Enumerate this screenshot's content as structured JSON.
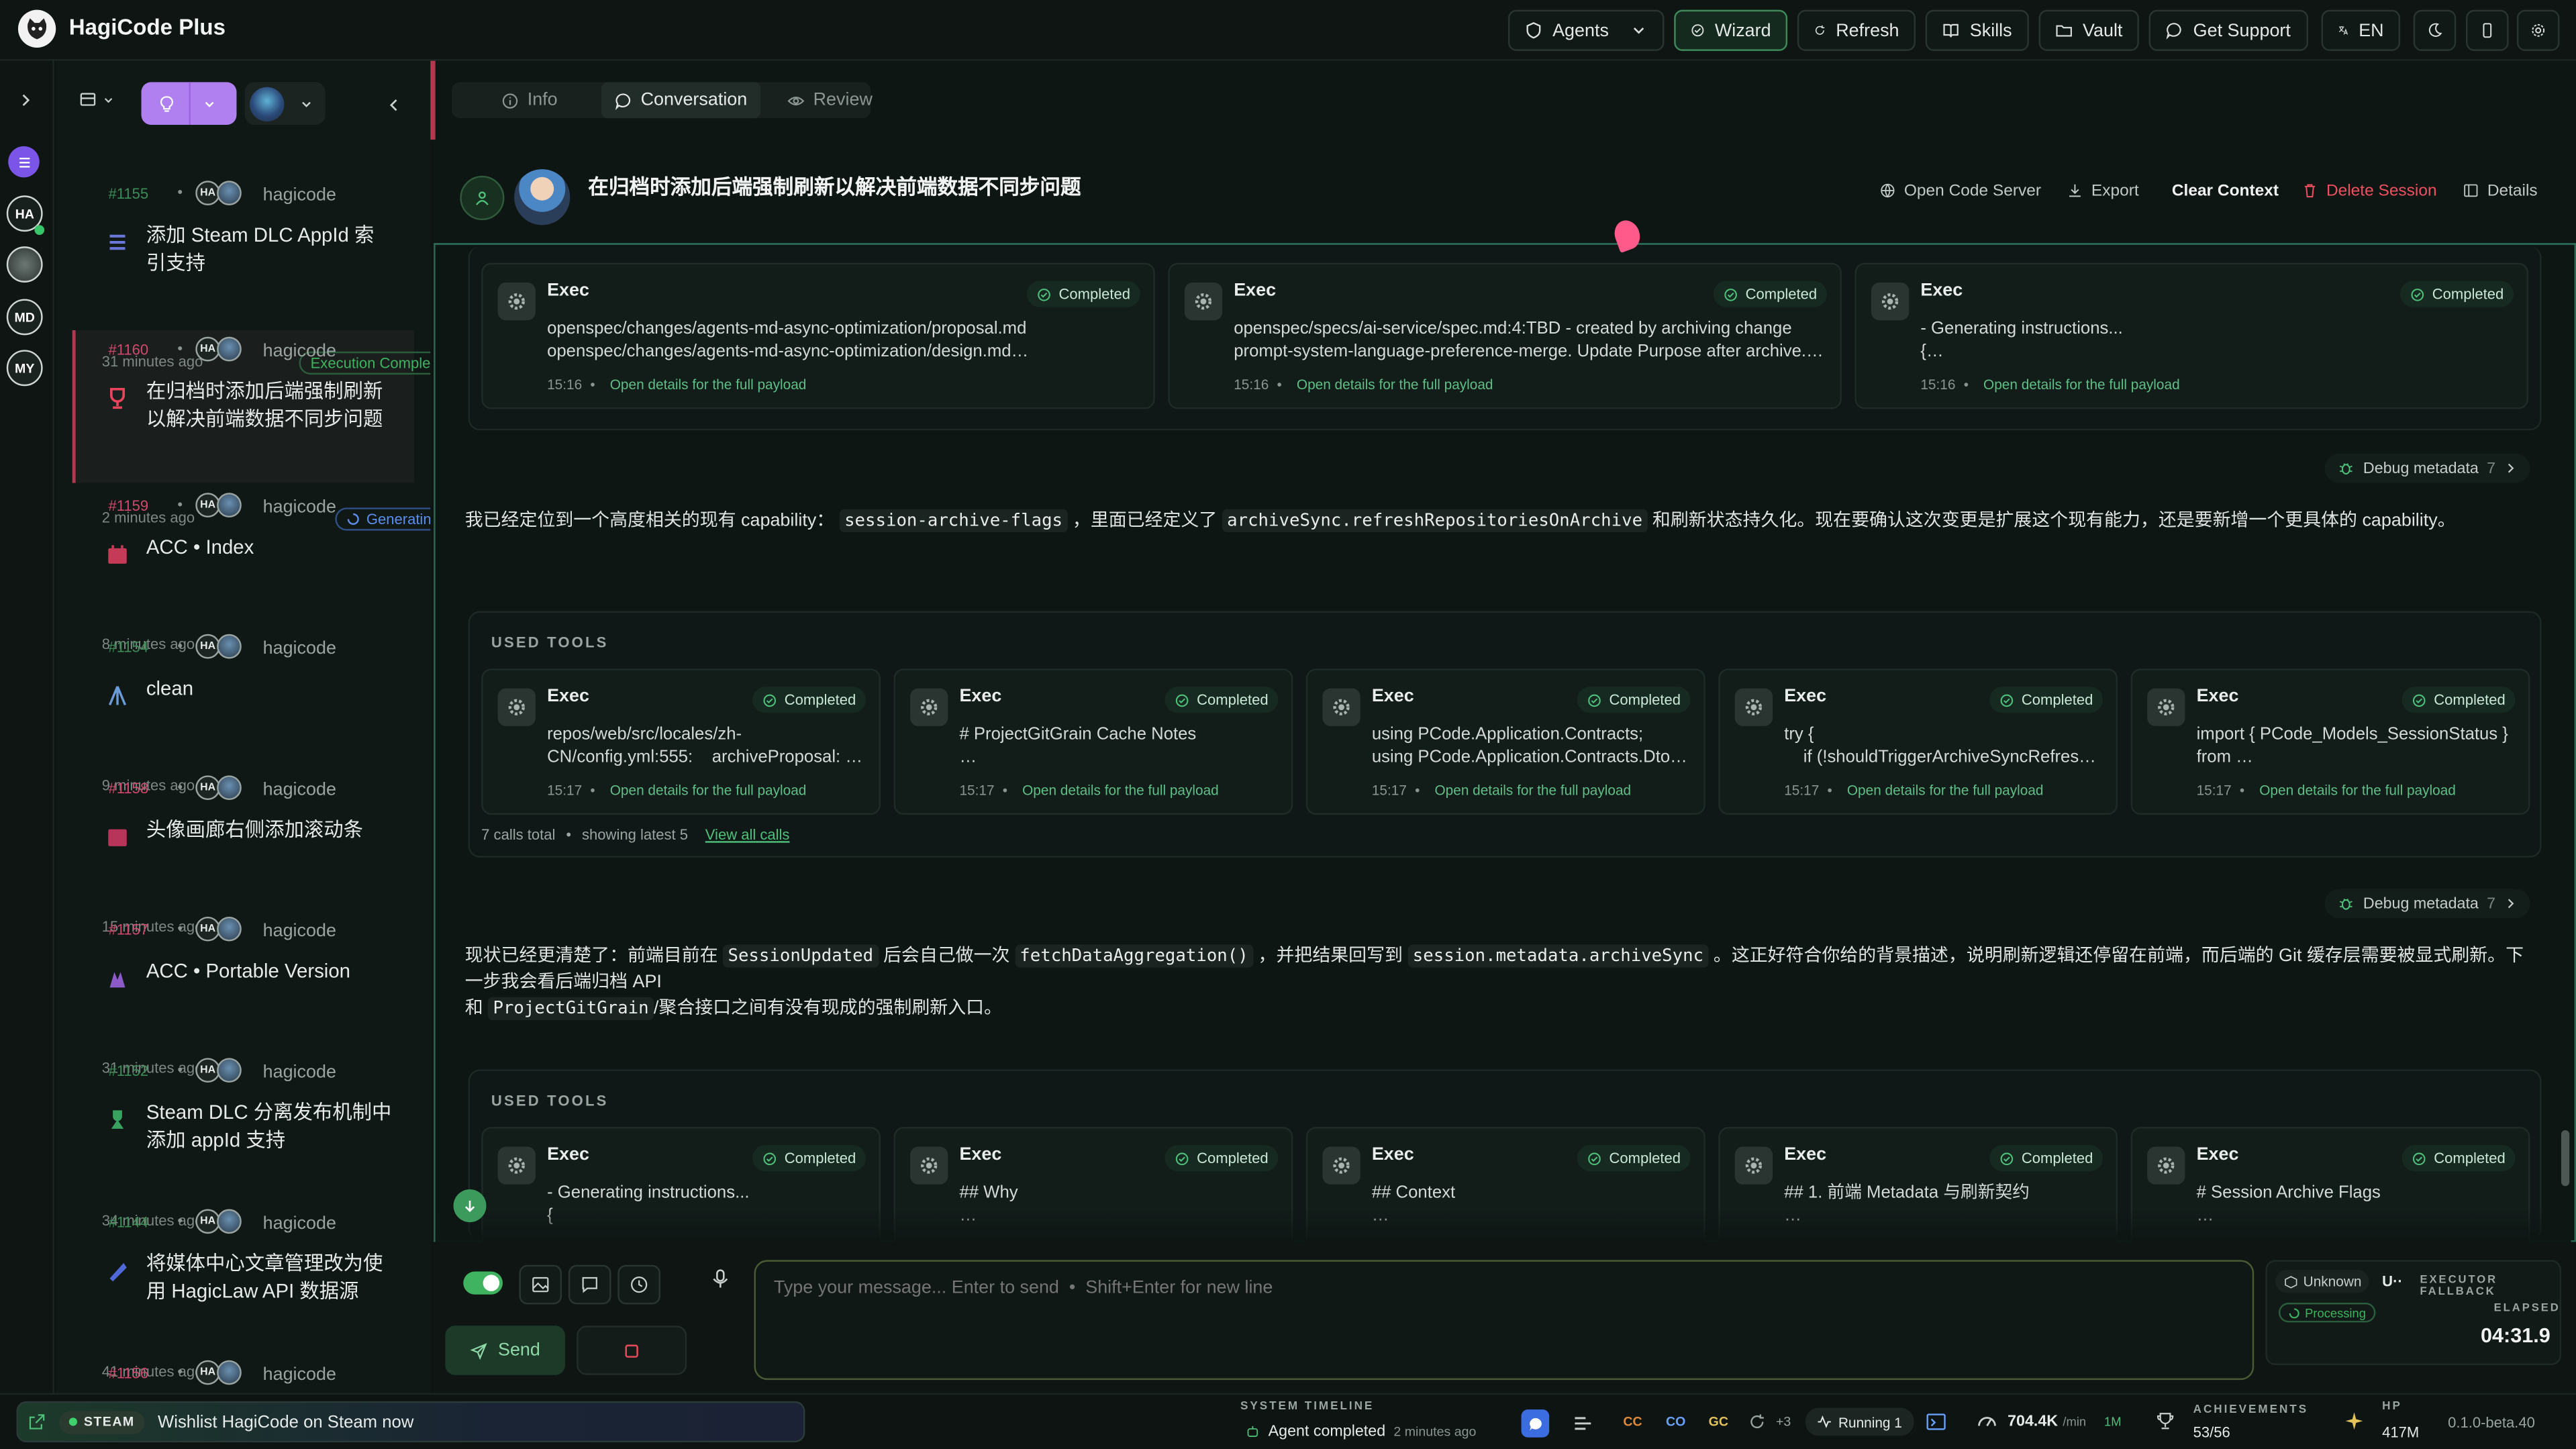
{
  "app": {
    "title": "HagiCode Plus"
  },
  "topbar": {
    "agents": "Agents",
    "wizard": "Wizard",
    "refresh": "Refresh",
    "skills": "Skills",
    "vault": "Vault",
    "support": "Get Support",
    "lang": "EN"
  },
  "rail": {
    "items": [
      "HA",
      "MD",
      "MY"
    ]
  },
  "sidebar": {
    "sessions": [
      {
        "id": "#1155",
        "user": "hagicode",
        "title": "添加 Steam DLC AppId 索引支持",
        "time": "31 minutes ago",
        "status": "Execution Complete",
        "idColor": "g"
      },
      {
        "id": "#1160",
        "user": "hagicode",
        "title": "在归档时添加后端强制刷新以解决前端数据不同步问题",
        "time": "2 minutes ago",
        "status": "Generating",
        "idColor": "r"
      },
      {
        "id": "#1159",
        "user": "hagicode",
        "title": "ACC  •  Index",
        "time": "8 minutes ago",
        "status": "",
        "idColor": "r"
      },
      {
        "id": "#1154",
        "user": "hagicode",
        "title": "clean",
        "time": "9 minutes ago",
        "status": "",
        "idColor": "g"
      },
      {
        "id": "#1158",
        "user": "hagicode",
        "title": "头像画廊右侧添加滚动条",
        "time": "15 minutes ago",
        "status": "",
        "idColor": "r"
      },
      {
        "id": "#1157",
        "user": "hagicode",
        "title": "ACC  •  Portable Version",
        "time": "31 minutes ago",
        "status": "",
        "idColor": "r"
      },
      {
        "id": "#1152",
        "user": "hagicode",
        "title": "Steam DLC 分离发布机制中添加 appId 支持",
        "time": "34 minutes ago",
        "status": "",
        "idColor": "g"
      },
      {
        "id": "#1144",
        "user": "hagicode",
        "title": "将媒体中心文章管理改为使用 HagicLaw API 数据源",
        "time": "41 minutes ago",
        "status": "",
        "idColor": "g"
      },
      {
        "id": "#1156",
        "user": "hagicode",
        "title": "",
        "time": "",
        "status": "",
        "idColor": "r"
      }
    ]
  },
  "tabs": {
    "info": "Info",
    "conversation": "Conversation",
    "review": "Review"
  },
  "session": {
    "title": "在归档时添加后端强制刷新以解决前端数据不同步问题",
    "open_code_server": "Open Code Server",
    "export": "Export",
    "clear_context": "Clear Context",
    "delete_session": "Delete Session",
    "details": "Details"
  },
  "chat": {
    "top_cards": [
      {
        "title": "Exec",
        "status": "Completed",
        "line1": "openspec/changes/agents-md-async-optimization/proposal.md",
        "line2": "openspec/changes/agents-md-async-optimization/design.md…",
        "time": "15:16",
        "link": "Open details for the full payload"
      },
      {
        "title": "Exec",
        "status": "Completed",
        "line1": "openspec/specs/ai-service/spec.md:4:TBD - created by archiving change",
        "line2": "prompt-system-language-preference-merge. Update Purpose after archive.…",
        "time": "15:16",
        "link": "Open details for the full payload"
      },
      {
        "title": "Exec",
        "status": "Completed",
        "line1": "- Generating instructions...",
        "line2": "{…",
        "time": "15:16",
        "link": "Open details for the full payload"
      }
    ],
    "debug_label": "Debug metadata",
    "debug_count": "7",
    "msg1": {
      "a": "我已经定位到一个高度相关的现有 capability：",
      "c1": "session-archive-flags",
      "b": "，里面已经定义了",
      "c2": "archiveSync.refreshRepositoriesOnArchive",
      "d": "和刷新状态持久化。现在要确认这次变更是扩展这个现有能力，还是要新增一个更具体的 capability。"
    },
    "used_tools": "USED TOOLS",
    "tool_cards_1": [
      {
        "title": "Exec",
        "status": "Completed",
        "line1": "repos/web/src/locales/zh-",
        "line2": "CN/config.yml:555:    archiveProposal: …",
        "time": "15:17",
        "link": "Open details for the full payload"
      },
      {
        "title": "Exec",
        "status": "Completed",
        "line1": "# ProjectGitGrain Cache Notes",
        "line2": "…",
        "time": "15:17",
        "link": "Open details for the full payload"
      },
      {
        "title": "Exec",
        "status": "Completed",
        "line1": "using PCode.Application.Contracts;",
        "line2": "using PCode.Application.Contracts.Dto…",
        "time": "15:17",
        "link": "Open details for the full payload"
      },
      {
        "title": "Exec",
        "status": "Completed",
        "line1": "try {",
        "line2": "    if (!shouldTriggerArchiveSyncRefres…",
        "time": "15:17",
        "link": "Open details for the full payload"
      },
      {
        "title": "Exec",
        "status": "Completed",
        "line1": "import { PCode_Models_SessionStatus }",
        "line2": "from …",
        "time": "15:17",
        "link": "Open details for the full payload"
      }
    ],
    "calls_total": "7 calls total",
    "showing": "showing latest 5",
    "view_all": "View all calls",
    "msg2": {
      "a": "现状已经更清楚了：前端目前在",
      "c1": "SessionUpdated",
      "b": "后会自己做一次",
      "c2": "fetchDataAggregation()",
      "d": "，并把结果回写到",
      "c3": "session.metadata.archiveSync",
      "e": "。这正好符合你给的背景描述，说明刷新逻辑还停留在前端，而后端的 Git 缓存层需要被显式刷新。下一步我会看后端归档 API",
      "f": "和",
      "c4": "ProjectGitGrain",
      "g": "/聚合接口之间有没有现成的强制刷新入口。"
    },
    "tool_cards_2": [
      {
        "title": "Exec",
        "status": "Completed",
        "line1": "- Generating instructions...",
        "line2": "{",
        "time": "",
        "link": ""
      },
      {
        "title": "Exec",
        "status": "Completed",
        "line1": "## Why",
        "line2": "…",
        "time": "",
        "link": ""
      },
      {
        "title": "Exec",
        "status": "Completed",
        "line1": "## Context",
        "line2": "…",
        "time": "",
        "link": ""
      },
      {
        "title": "Exec",
        "status": "Completed",
        "line1": "## 1. 前端 Metadata 与刷新契约",
        "line2": "…",
        "time": "",
        "link": ""
      },
      {
        "title": "Exec",
        "status": "Completed",
        "line1": "# Session Archive Flags",
        "line2": "…",
        "time": "",
        "link": ""
      }
    ]
  },
  "composer": {
    "placeholder": "Type your message... Enter to send  •  Shift+Enter for new line",
    "send": "Send",
    "unknown": "Unknown",
    "u_label": "U··",
    "executor": "EXECUTOR FALLBACK",
    "processing": "Processing",
    "elapsed_label": "ELAPSED",
    "elapsed": "04:31.9"
  },
  "bottom": {
    "steam": "STEAM",
    "wishlist": "Wishlist HagiCode on Steam now",
    "timeline_label": "SYSTEM TIMELINE",
    "timeline_event": "Agent completed",
    "timeline_time": "2 minutes ago",
    "cc": "CC",
    "co": "CO",
    "gc": "GC",
    "plus": "+3",
    "running": "Running 1",
    "rate": "704.4K",
    "rate_unit": "/min",
    "rate_sub": "1M",
    "achievements_label": "ACHIEVEMENTS",
    "achievements": "53/56",
    "hp_label": "HP",
    "hp": "417M",
    "version": "0.1.0-beta.40"
  }
}
